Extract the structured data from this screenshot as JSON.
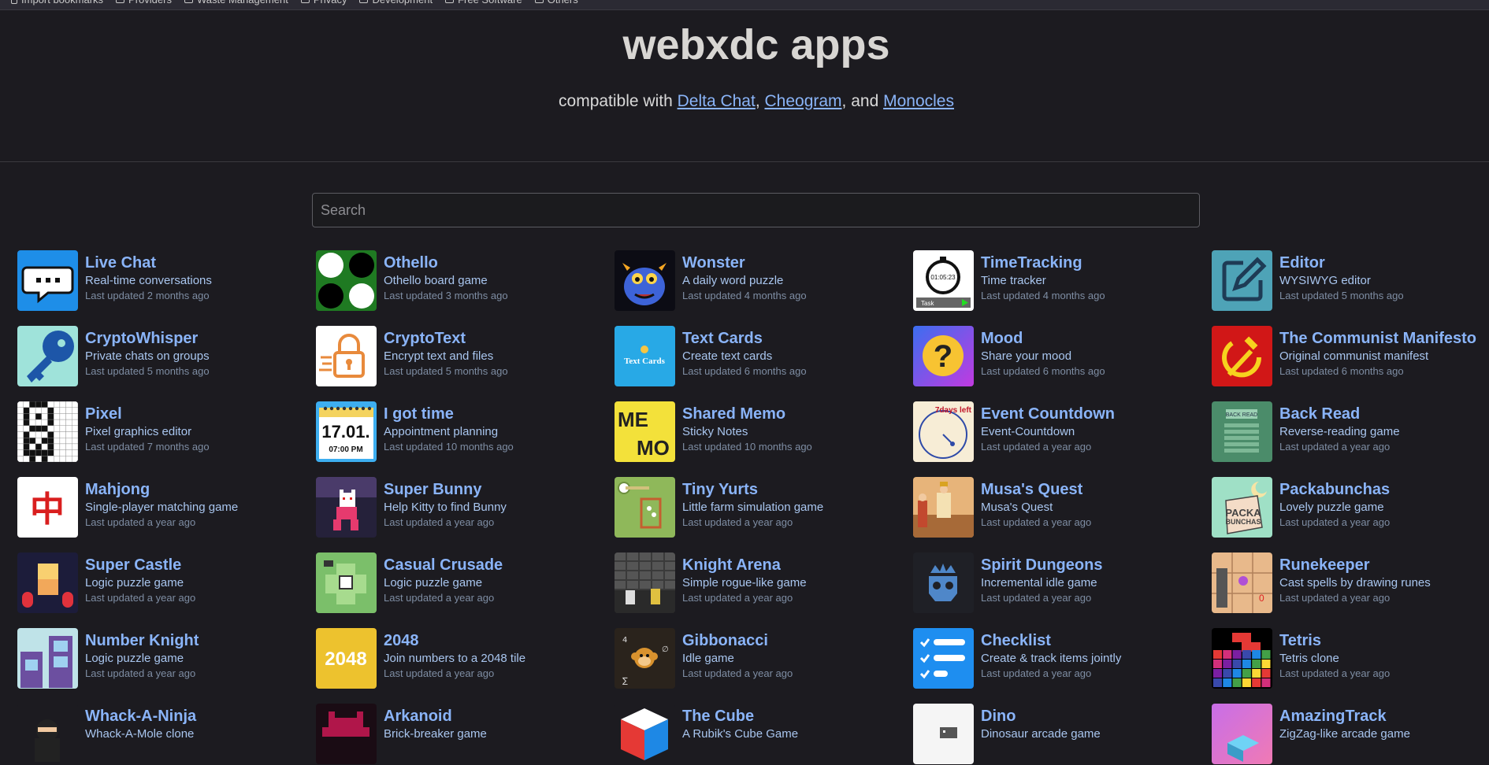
{
  "bookmarks": [
    {
      "label": "Import bookmarks",
      "icon": "page-icon"
    },
    {
      "label": "Providers",
      "icon": "folder-icon"
    },
    {
      "label": "Waste Management",
      "icon": "folder-icon"
    },
    {
      "label": "Privacy",
      "icon": "folder-icon"
    },
    {
      "label": "Development",
      "icon": "folder-icon"
    },
    {
      "label": "Free Software",
      "icon": "folder-icon"
    },
    {
      "label": "Others",
      "icon": "folder-icon"
    }
  ],
  "header": {
    "title": "webxdc apps",
    "subtitle_prefix": "compatible with ",
    "link1": "Delta Chat",
    "sep1": ", ",
    "link2": "Cheogram",
    "sep2": ", and ",
    "link3": "Monocles"
  },
  "search": {
    "placeholder": "Search"
  },
  "colors": {
    "background": "#1c1b20",
    "link": "#8ab4f8"
  },
  "apps": [
    {
      "name": "Live Chat",
      "desc": "Real-time conversations",
      "updated": "Last updated 2 months ago",
      "icon": "chat-bubble-icon"
    },
    {
      "name": "Othello",
      "desc": "Othello board game",
      "updated": "Last updated 3 months ago",
      "icon": "othello-board-icon"
    },
    {
      "name": "Wonster",
      "desc": "A daily word puzzle",
      "updated": "Last updated 4 months ago",
      "icon": "blue-monster-icon"
    },
    {
      "name": "TimeTracking",
      "desc": "Time tracker",
      "updated": "Last updated 4 months ago",
      "icon": "stopwatch-icon",
      "icon_text": "01:05:23",
      "icon_label": "Task"
    },
    {
      "name": "Editor",
      "desc": "WYSIWYG editor",
      "updated": "Last updated 5 months ago",
      "icon": "edit-pencil-icon"
    },
    {
      "name": "CryptoWhisper",
      "desc": "Private chats on groups",
      "updated": "Last updated 5 months ago",
      "icon": "key-icon"
    },
    {
      "name": "CryptoText",
      "desc": "Encrypt text and files",
      "updated": "Last updated 5 months ago",
      "icon": "padlock-icon"
    },
    {
      "name": "Text Cards",
      "desc": "Create text cards",
      "updated": "Last updated 6 months ago",
      "icon": "text-cards-icon",
      "icon_text": "Text Cards"
    },
    {
      "name": "Mood",
      "desc": "Share your mood",
      "updated": "Last updated 6 months ago",
      "icon": "question-mood-icon",
      "icon_text": "?"
    },
    {
      "name": "The Communist Manifesto",
      "desc": "Original communist manifest",
      "updated": "Last updated 6 months ago",
      "icon": "hammer-sickle-icon"
    },
    {
      "name": "Pixel",
      "desc": "Pixel graphics editor",
      "updated": "Last updated 7 months ago",
      "icon": "pixel-grid-icon"
    },
    {
      "name": "I got time",
      "desc": "Appointment planning",
      "updated": "Last updated 10 months ago",
      "icon": "calendar-icon",
      "icon_text": "17.01.",
      "icon_sub": "07:00 PM"
    },
    {
      "name": "Shared Memo",
      "desc": "Sticky Notes",
      "updated": "Last updated 10 months ago",
      "icon": "memo-icon",
      "icon_text": "ME",
      "icon_sub": "MO"
    },
    {
      "name": "Event Countdown",
      "desc": "Event-Countdown",
      "updated": "Last updated a year ago",
      "icon": "countdown-clock-icon",
      "icon_text": "7days left"
    },
    {
      "name": "Back Read",
      "desc": "Reverse-reading game",
      "updated": "Last updated a year ago",
      "icon": "back-read-icon",
      "icon_text": "BACK READ"
    },
    {
      "name": "Mahjong",
      "desc": "Single-player matching game",
      "updated": "Last updated a year ago",
      "icon": "mahjong-tile-icon",
      "icon_text": "中"
    },
    {
      "name": "Super Bunny",
      "desc": "Help Kitty to find Bunny",
      "updated": "Last updated a year ago",
      "icon": "pixel-cat-icon"
    },
    {
      "name": "Tiny Yurts",
      "desc": "Little farm simulation game",
      "updated": "Last updated a year ago",
      "icon": "farm-field-icon"
    },
    {
      "name": "Musa's Quest",
      "desc": "Musa's Quest",
      "updated": "Last updated a year ago",
      "icon": "desert-scene-icon"
    },
    {
      "name": "Packabunchas",
      "desc": "Lovely puzzle game",
      "updated": "Last updated a year ago",
      "icon": "packabunchas-icon",
      "icon_text": "PACKA",
      "icon_sub": "BUNCHAS"
    },
    {
      "name": "Super Castle",
      "desc": "Logic puzzle game",
      "updated": "Last updated a year ago",
      "icon": "castle-blocks-icon"
    },
    {
      "name": "Casual Crusade",
      "desc": "Logic puzzle game",
      "updated": "Last updated a year ago",
      "icon": "green-cross-map-icon"
    },
    {
      "name": "Knight Arena",
      "desc": "Simple rogue-like game",
      "updated": "Last updated a year ago",
      "icon": "dungeon-knights-icon"
    },
    {
      "name": "Spirit Dungeons",
      "desc": "Incremental idle game",
      "updated": "Last updated a year ago",
      "icon": "crowned-skull-icon"
    },
    {
      "name": "Runekeeper",
      "desc": "Cast spells by drawing runes",
      "updated": "Last updated a year ago",
      "icon": "rune-board-icon"
    },
    {
      "name": "Number Knight",
      "desc": "Logic puzzle game",
      "updated": "Last updated a year ago",
      "icon": "tower-knight-icon"
    },
    {
      "name": "2048",
      "desc": "Join numbers to a 2048 tile",
      "updated": "Last updated a year ago",
      "icon": "tile-2048-icon",
      "icon_text": "2048"
    },
    {
      "name": "Gibbonacci",
      "desc": "Idle game",
      "updated": "Last updated a year ago",
      "icon": "monkey-math-icon"
    },
    {
      "name": "Checklist",
      "desc": "Create & track items jointly",
      "updated": "Last updated a year ago",
      "icon": "checklist-icon"
    },
    {
      "name": "Tetris",
      "desc": "Tetris clone",
      "updated": "Last updated a year ago",
      "icon": "tetris-blocks-icon"
    },
    {
      "name": "Whack-A-Ninja",
      "desc": "Whack-A-Mole clone",
      "updated": "",
      "icon": "ninja-icon"
    },
    {
      "name": "Arkanoid",
      "desc": "Brick-breaker game",
      "updated": "",
      "icon": "space-invader-icon"
    },
    {
      "name": "The Cube",
      "desc": "A Rubik's Cube Game",
      "updated": "",
      "icon": "rubiks-cube-icon"
    },
    {
      "name": "Dino",
      "desc": "Dinosaur arcade game",
      "updated": "",
      "icon": "dino-icon"
    },
    {
      "name": "AmazingTrack",
      "desc": "ZigZag-like arcade game",
      "updated": "",
      "icon": "zigzag-track-icon"
    }
  ]
}
